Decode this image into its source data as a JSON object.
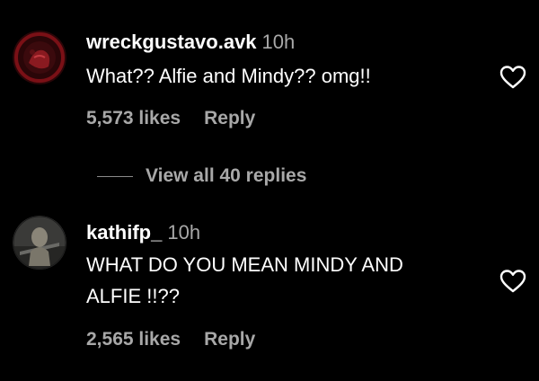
{
  "comments": [
    {
      "username": "wreckgustavo.avk",
      "time": "10h",
      "text_lines": [
        "What?? Alfie and Mindy?? omg!!"
      ],
      "likes": "5,573 likes",
      "reply_label": "Reply",
      "avatar_icon": "dark-red-avatar"
    },
    {
      "username": "kathifp_",
      "time": "10h",
      "text_lines": [
        "WHAT DO YOU MEAN MINDY AND",
        "ALFIE !!??"
      ],
      "likes": "2,565 likes",
      "reply_label": "Reply",
      "avatar_icon": "grey-avatar"
    }
  ],
  "view_replies": {
    "label": "View all 40 replies"
  },
  "icons": {
    "like": "heart-outline-icon"
  },
  "colors": {
    "background": "#000000",
    "primary_text": "#ffffff",
    "secondary_text": "#a8a8a8"
  }
}
